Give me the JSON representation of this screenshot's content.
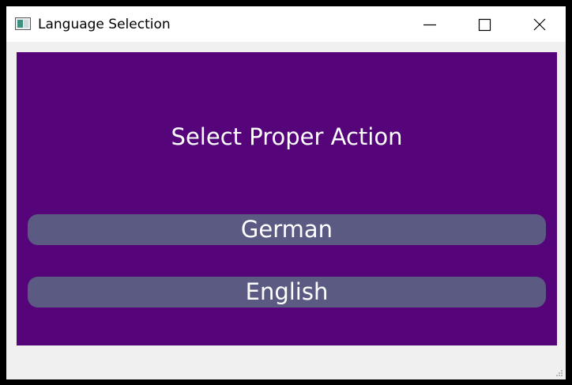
{
  "window": {
    "title": "Language Selection",
    "icon": "app-window-icon",
    "controls": {
      "minimize_icon": "minimize-icon",
      "maximize_icon": "maximize-icon",
      "close_icon": "close-icon"
    }
  },
  "main": {
    "heading": "Select Proper Action",
    "buttons": [
      {
        "label": "German"
      },
      {
        "label": "English"
      }
    ]
  },
  "colors": {
    "panel_background": "#55047a",
    "button_background": "#5a5a82",
    "button_text": "#ffffff",
    "window_background": "#f0f0f0"
  }
}
